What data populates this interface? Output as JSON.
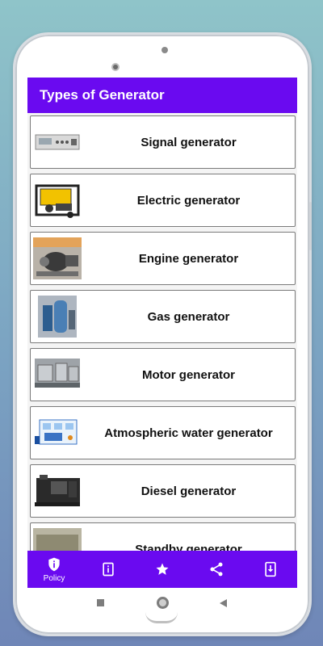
{
  "appbar": {
    "title": "Types of Generator"
  },
  "list": [
    {
      "label": "Signal generator",
      "thumb": "signal-generator-thumbnail"
    },
    {
      "label": "Electric generator",
      "thumb": "electric-generator-thumbnail"
    },
    {
      "label": "Engine generator",
      "thumb": "engine-generator-thumbnail"
    },
    {
      "label": "Gas generator",
      "thumb": "gas-generator-thumbnail"
    },
    {
      "label": "Motor generator",
      "thumb": "motor-generator-thumbnail"
    },
    {
      "label": "Atmospheric water generator",
      "thumb": "atmospheric-water-generator-thumbnail"
    },
    {
      "label": "Diesel generator",
      "thumb": "diesel-generator-thumbnail"
    },
    {
      "label": "Standby generator",
      "thumb": "standby-generator-thumbnail"
    }
  ],
  "bottom_nav": {
    "policy_label": "Policy",
    "items": [
      "policy-icon",
      "info-icon",
      "star-icon",
      "share-icon",
      "download-icon"
    ]
  },
  "colors": {
    "accent": "#6a0af0",
    "screen_bg": "#f4f4f4",
    "card_border": "#7a7a7a"
  }
}
